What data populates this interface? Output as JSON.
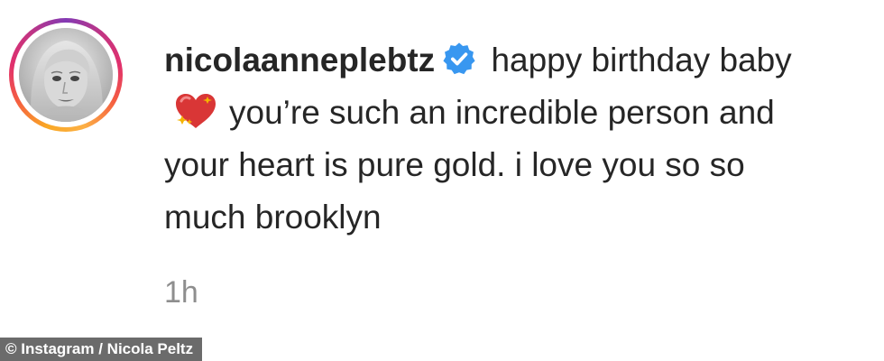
{
  "comment": {
    "username": "nicolaanneplebtz",
    "verified_icon": "verified-badge-icon",
    "verified_color": "#3897f0",
    "text_before_emoji": "happy birthday baby",
    "emoji": "sparkling-heart-icon",
    "text_after_emoji": "you’re such an incredible person and your heart is pure gold. i love you so so much brooklyn",
    "timestamp": "1h"
  },
  "credit": {
    "text": "© Instagram / Nicola Peltz"
  },
  "colors": {
    "text": "#262626",
    "muted": "#8e8e8e",
    "credit_bg": "#6b6b6b"
  }
}
